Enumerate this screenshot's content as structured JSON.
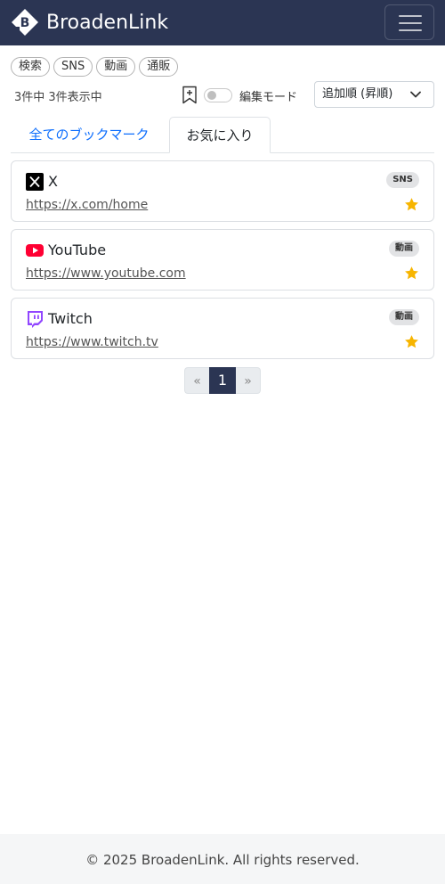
{
  "brand": {
    "name": "BroadenLink"
  },
  "tags": [
    "検索",
    "SNS",
    "動画",
    "通販"
  ],
  "status": {
    "count_text": "3件中 3件表示中",
    "edit_mode_label": "編集モード",
    "edit_mode_on": false
  },
  "sort": {
    "selected": "追加順 (昇順)"
  },
  "tabs": [
    {
      "label": "全てのブックマーク",
      "active": false
    },
    {
      "label": "お気に入り",
      "active": true
    }
  ],
  "bookmarks": [
    {
      "title": "X",
      "url": "https://x.com/home",
      "tag": "SNS",
      "icon": "x-logo-icon",
      "favorite": true
    },
    {
      "title": "YouTube",
      "url": "https://www.youtube.com",
      "tag": "動画",
      "icon": "youtube-logo-icon",
      "favorite": true
    },
    {
      "title": "Twitch",
      "url": "https://www.twitch.tv",
      "tag": "動画",
      "icon": "twitch-logo-icon",
      "favorite": true
    }
  ],
  "pagination": {
    "prev": "«",
    "current": "1",
    "next": "»"
  },
  "footer": {
    "text": "© 2025 BroadenLink. All rights reserved."
  },
  "colors": {
    "navbar": "#2b3553",
    "link": "#0d6efd",
    "star": "#f7b500",
    "youtube": "#ff0033",
    "twitch": "#9146ff"
  }
}
